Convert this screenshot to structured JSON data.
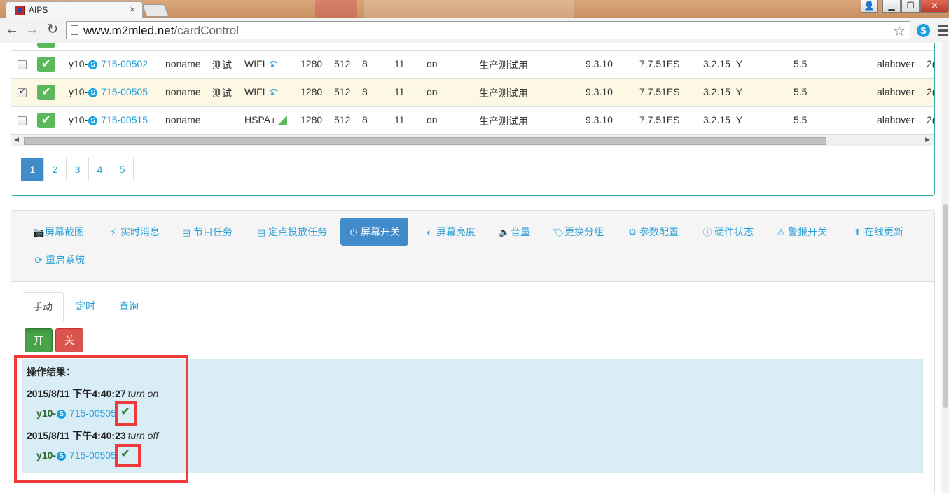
{
  "browser": {
    "tab_title": "AIPS",
    "tab_close": "×",
    "url_host": "www.m2mled.net",
    "url_path": "/cardControl",
    "window_controls": [
      "minimize",
      "restore",
      "close"
    ]
  },
  "table": {
    "rows": [
      {
        "checked": false,
        "id_prefix": "y10-",
        "id_link": "715-00502",
        "name": "noname",
        "tag": "测试",
        "network": "WIFI",
        "network_icon": "wifi-icon",
        "width": "1280",
        "height": "512",
        "c1": "8",
        "c2": "11",
        "power": "on",
        "usage": "生产测试用",
        "v1": "9.3.10",
        "v2": "7.7.51ES",
        "v3": "3.2.15_Y",
        "v4": "5.5",
        "user": "alahover",
        "trunc": "2("
      },
      {
        "checked": true,
        "id_prefix": "y10-",
        "id_link": "715-00505",
        "name": "noname",
        "tag": "测试",
        "network": "WIFI",
        "network_icon": "wifi-icon",
        "width": "1280",
        "height": "512",
        "c1": "8",
        "c2": "11",
        "power": "on",
        "usage": "生产测试用",
        "v1": "9.3.10",
        "v2": "7.7.51ES",
        "v3": "3.2.15_Y",
        "v4": "5.5",
        "user": "alahover",
        "trunc": "2("
      },
      {
        "checked": false,
        "id_prefix": "y10-",
        "id_link": "715-00515",
        "name": "noname",
        "tag": "",
        "network": "HSPA+",
        "network_icon": "signal-icon",
        "width": "1280",
        "height": "512",
        "c1": "8",
        "c2": "11",
        "power": "on",
        "usage": "生产测试用",
        "v1": "9.3.10",
        "v2": "7.7.51ES",
        "v3": "3.2.15_Y",
        "v4": "5.5",
        "user": "alahover",
        "trunc": "2("
      }
    ]
  },
  "pagination": {
    "pages": [
      "1",
      "2",
      "3",
      "4",
      "5"
    ],
    "active": "1"
  },
  "functions": {
    "buttons": [
      {
        "label": "屏幕截图",
        "icon": "camera-icon"
      },
      {
        "label": "实时消息",
        "icon": "bolt-icon"
      },
      {
        "label": "节目任务",
        "icon": "film-icon"
      },
      {
        "label": "定点投放任务",
        "icon": "film-icon"
      },
      {
        "label": "屏幕开关",
        "icon": "power-icon"
      },
      {
        "label": "屏幕亮度",
        "icon": "adjust-icon"
      },
      {
        "label": "音量",
        "icon": "volume-icon"
      },
      {
        "label": "更换分组",
        "icon": "tag-icon"
      },
      {
        "label": "参数配置",
        "icon": "cog-icon"
      },
      {
        "label": "硬件状态",
        "icon": "info-icon"
      },
      {
        "label": "警报开关",
        "icon": "warning-icon"
      },
      {
        "label": "在线更新",
        "icon": "arrow-up-icon"
      },
      {
        "label": "重启系统",
        "icon": "refresh-icon"
      }
    ],
    "active": "屏幕开关"
  },
  "subtabs": [
    "手动",
    "定时",
    "查询"
  ],
  "active_subtab": "手动",
  "actions": {
    "on": "开",
    "off": "关"
  },
  "result": {
    "title": "操作结果：",
    "logs": [
      {
        "time": "2015/8/11 下午4:40:27",
        "action": "turn on",
        "device_prefix": "y10-",
        "device_link": "715-00505"
      },
      {
        "time": "2015/8/11 下午4:40:23",
        "action": "turn off",
        "device_prefix": "y10-",
        "device_link": "715-00505"
      }
    ]
  },
  "colors": {
    "link": "#2a9fd6",
    "primary": "#428bca",
    "success": "#5cb85c",
    "danger": "#d9534f",
    "info_bg": "#d9edf7",
    "highlight": "#f03a3a"
  }
}
